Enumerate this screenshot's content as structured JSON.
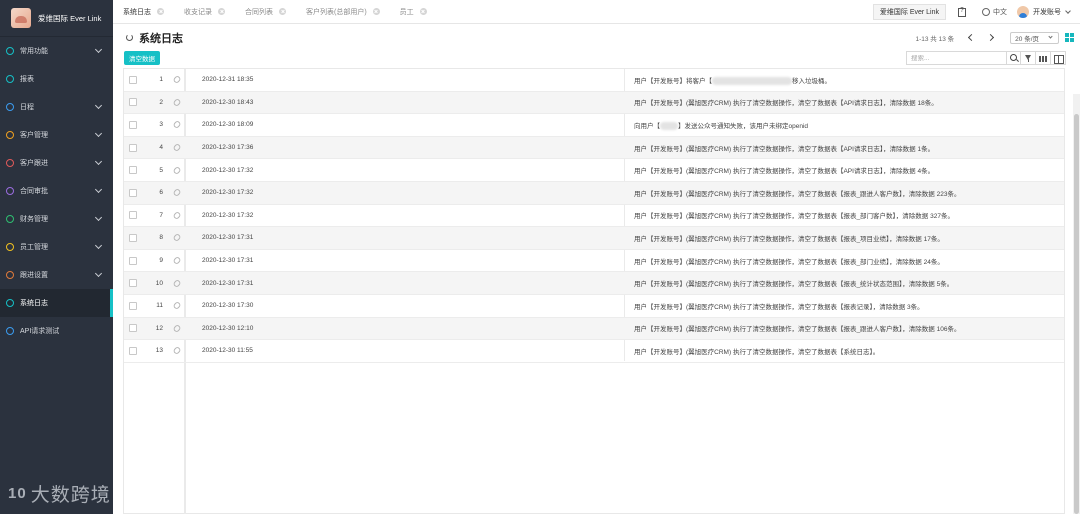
{
  "brand": {
    "name": "爱维国际 Ever Link"
  },
  "sidebar": {
    "items": [
      {
        "label": "常用功能",
        "has_children": true,
        "icon": "star-icon",
        "color": "#16c0c6"
      },
      {
        "label": "报表",
        "has_children": false,
        "icon": "report-icon",
        "color": "#16c0c6"
      },
      {
        "label": "日程",
        "has_children": true,
        "icon": "calendar-icon",
        "color": "#3b9cf0"
      },
      {
        "label": "客户管理",
        "has_children": true,
        "icon": "customer-icon",
        "color": "#f0a020"
      },
      {
        "label": "客户跟进",
        "has_children": true,
        "icon": "followup-icon",
        "color": "#e05a5a"
      },
      {
        "label": "合同审批",
        "has_children": true,
        "icon": "contract-icon",
        "color": "#9b6de0"
      },
      {
        "label": "财务管理",
        "has_children": true,
        "icon": "finance-icon",
        "color": "#2fbf71"
      },
      {
        "label": "员工管理",
        "has_children": true,
        "icon": "staff-icon",
        "color": "#f0c020"
      },
      {
        "label": "跟进设置",
        "has_children": true,
        "icon": "settings-icon",
        "color": "#e07a3a"
      },
      {
        "label": "系统日志",
        "has_children": false,
        "icon": "log-icon",
        "color": "#16c0c6",
        "active": true
      },
      {
        "label": "API请求测试",
        "has_children": false,
        "icon": "api-icon",
        "color": "#3b9cf0"
      }
    ],
    "watermark": "大数跨境",
    "watermark_mark": "10"
  },
  "tabs": [
    {
      "label": "系统日志",
      "active": true
    },
    {
      "label": "收支记录",
      "active": false
    },
    {
      "label": "合同列表",
      "active": false
    },
    {
      "label": "客户列表(总部用户)",
      "active": false
    },
    {
      "label": "员工",
      "active": false
    }
  ],
  "topbar": {
    "org_button": "爱维国际 Ever Link",
    "language": "中文",
    "user": "开发账号"
  },
  "page": {
    "title": "系统日志",
    "clear_button": "清空数据",
    "pager_range": "1-13  共 13 条",
    "page_size": "20 条/页",
    "search_placeholder": "搜索..."
  },
  "accent_color": "#16c0c6",
  "logs": [
    {
      "index": "1",
      "time": "2020-12-31 18:35",
      "msg_pre": "用户【开发账号】将客户【",
      "msg_post": "移入垃圾桶。",
      "blurred": true
    },
    {
      "index": "2",
      "time": "2020-12-30 18:43",
      "msg": "用户【开发账号】(翼旭医疗CRM) 执行了清空数据操作，清空了数据表【API请求日志】，清除数据 18条。"
    },
    {
      "index": "3",
      "time": "2020-12-30 18:09",
      "msg_pre": "向用户【",
      "msg_post": "】发送公众号通知失败，该用户未绑定openid",
      "blurred_small": true
    },
    {
      "index": "4",
      "time": "2020-12-30 17:36",
      "msg": "用户【开发账号】(翼旭医疗CRM) 执行了清空数据操作，清空了数据表【API请求日志】，清除数据 1条。"
    },
    {
      "index": "5",
      "time": "2020-12-30 17:32",
      "msg": "用户【开发账号】(翼旭医疗CRM) 执行了清空数据操作，清空了数据表【API请求日志】，清除数据 4条。"
    },
    {
      "index": "6",
      "time": "2020-12-30 17:32",
      "msg": "用户【开发账号】(翼旭医疗CRM) 执行了清空数据操作，清空了数据表【报表_跟进人客户数】，清除数据 223条。"
    },
    {
      "index": "7",
      "time": "2020-12-30 17:32",
      "msg": "用户【开发账号】(翼旭医疗CRM) 执行了清空数据操作，清空了数据表【报表_部门客户数】，清除数据 327条。"
    },
    {
      "index": "8",
      "time": "2020-12-30 17:31",
      "msg": "用户【开发账号】(翼旭医疗CRM) 执行了清空数据操作，清空了数据表【报表_项目业绩】，清除数据 17条。"
    },
    {
      "index": "9",
      "time": "2020-12-30 17:31",
      "msg": "用户【开发账号】(翼旭医疗CRM) 执行了清空数据操作，清空了数据表【报表_部门业绩】，清除数据 24条。"
    },
    {
      "index": "10",
      "time": "2020-12-30 17:31",
      "msg": "用户【开发账号】(翼旭医疗CRM) 执行了清空数据操作，清空了数据表【报表_统计状态范围】，清除数据 5条。"
    },
    {
      "index": "11",
      "time": "2020-12-30 17:30",
      "msg": "用户【开发账号】(翼旭医疗CRM) 执行了清空数据操作，清空了数据表【报表记录】，清除数据 3条。"
    },
    {
      "index": "12",
      "time": "2020-12-30 12:10",
      "msg": "用户【开发账号】(翼旭医疗CRM) 执行了清空数据操作，清空了数据表【报表_跟进人客户数】，清除数据 106条。"
    },
    {
      "index": "13",
      "time": "2020-12-30 11:55",
      "msg": "用户【开发账号】(翼旭医疗CRM) 执行了清空数据操作，清空了数据表【系统日志】。"
    }
  ]
}
